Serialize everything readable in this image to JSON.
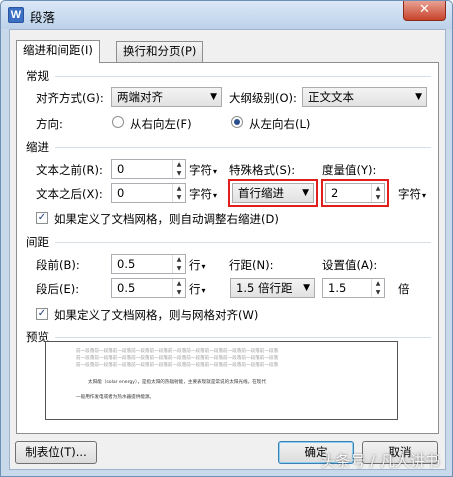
{
  "window": {
    "title": "段落",
    "app_icon": "W",
    "close_icon": "x-icon"
  },
  "tabs": [
    {
      "label": "缩进和间距(I)",
      "active": true
    },
    {
      "label": "换行和分页(P)",
      "active": false
    }
  ],
  "general": {
    "section": "常规",
    "align_label": "对齐方式(G):",
    "align_value": "两端对齐",
    "outline_label": "大纲级别(O):",
    "outline_value": "正文文本",
    "direction_label": "方向:",
    "rtl_label": "从右向左(F)",
    "ltr_label": "从左向右(L)",
    "ltr_selected": true
  },
  "indent": {
    "section": "缩进",
    "before_label": "文本之前(R):",
    "before_value": "0",
    "before_unit": "字符",
    "after_label": "文本之后(X):",
    "after_value": "0",
    "after_unit": "字符",
    "special_label": "特殊格式(S):",
    "special_value": "首行缩进",
    "measure_label": "度量值(Y):",
    "measure_value": "2",
    "measure_unit": "字符",
    "grid_checkbox": "如果定义了文档网格，则自动调整右缩进(D)",
    "grid_checked": true
  },
  "spacing": {
    "section": "间距",
    "before_label": "段前(B):",
    "before_value": "0.5",
    "before_unit": "行",
    "after_label": "段后(E):",
    "after_value": "0.5",
    "after_unit": "行",
    "line_label": "行距(N):",
    "line_value": "1.5 倍行距",
    "setting_label": "设置值(A):",
    "setting_value": "1.5",
    "setting_unit": "倍",
    "grid_checkbox": "如果定义了文档网格，则与网格对齐(W)",
    "grid_checked": true
  },
  "preview": {
    "section": "预览",
    "prev_lines": [
      "前一段落前一段落前一段落前一段落前一段落前一段落前一段落前一段落前一段落前一段落前一段落",
      "前一段落前一段落前一段落前一段落前一段落前一段落前一段落前一段落前一段落前一段落前一段落",
      "前一段落前一段落前一段落前一段落前一段落前一段落前一段落前一段落前一段落前一段落前一段落"
    ],
    "main_lines": [
      "太阳能（solar energy），是指太阳的热辐射能，主要表现就是常说的太阳光线。在现代",
      "一般用作发电或者为热水器提供能源。"
    ]
  },
  "buttons": {
    "tabstops": "制表位(T)...",
    "ok": "确定",
    "cancel": "取消"
  },
  "watermark": "头条号 / 凡人讲书"
}
